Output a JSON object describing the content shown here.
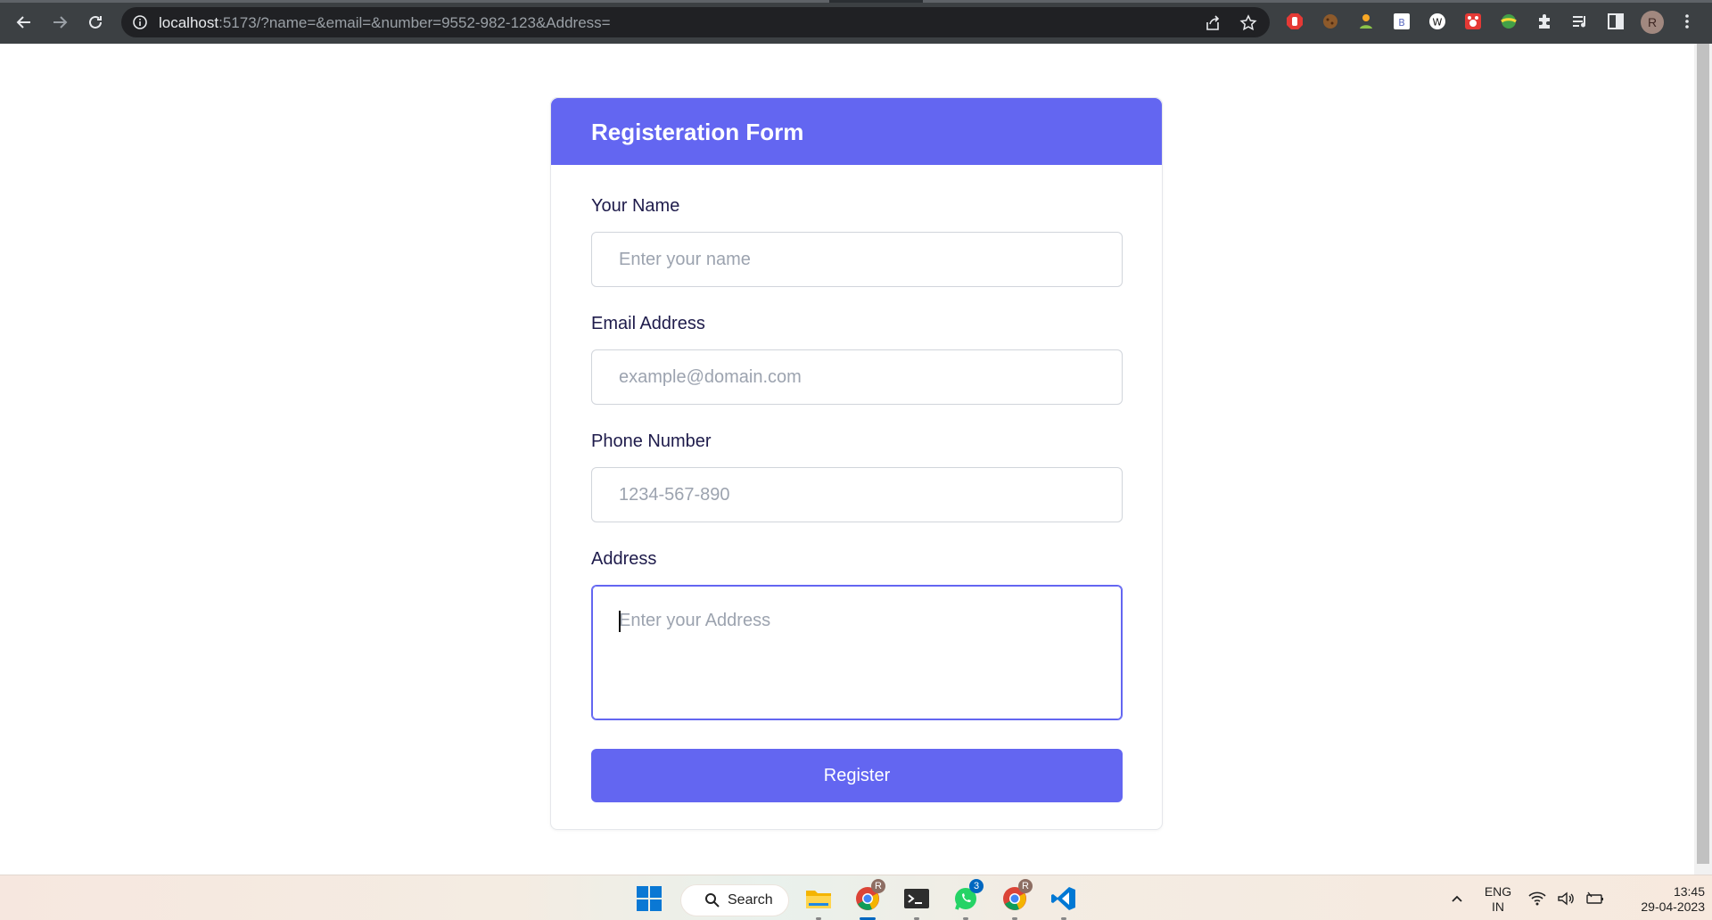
{
  "browser": {
    "url_host": "localhost",
    "url_rest": ":5173/?name=&email=&number=9552-982-123&Address=",
    "profile_initial": "R"
  },
  "form": {
    "title": "Registeration Form",
    "fields": [
      {
        "label": "Your Name",
        "placeholder": "Enter your name",
        "value": ""
      },
      {
        "label": "Email Address",
        "placeholder": "example@domain.com",
        "value": ""
      },
      {
        "label": "Phone Number",
        "placeholder": "1234-567-890",
        "value": ""
      },
      {
        "label": "Address",
        "placeholder": "Enter your Address",
        "value": ""
      }
    ],
    "submit_label": "Register",
    "accent_color": "#6366f1"
  },
  "taskbar": {
    "search_label": "Search",
    "whatsapp_badge": "3",
    "chrome_badge_1": "R",
    "chrome_badge_2": "R",
    "language_top": "ENG",
    "language_bottom": "IN",
    "time": "13:45",
    "date": "29-04-2023"
  }
}
